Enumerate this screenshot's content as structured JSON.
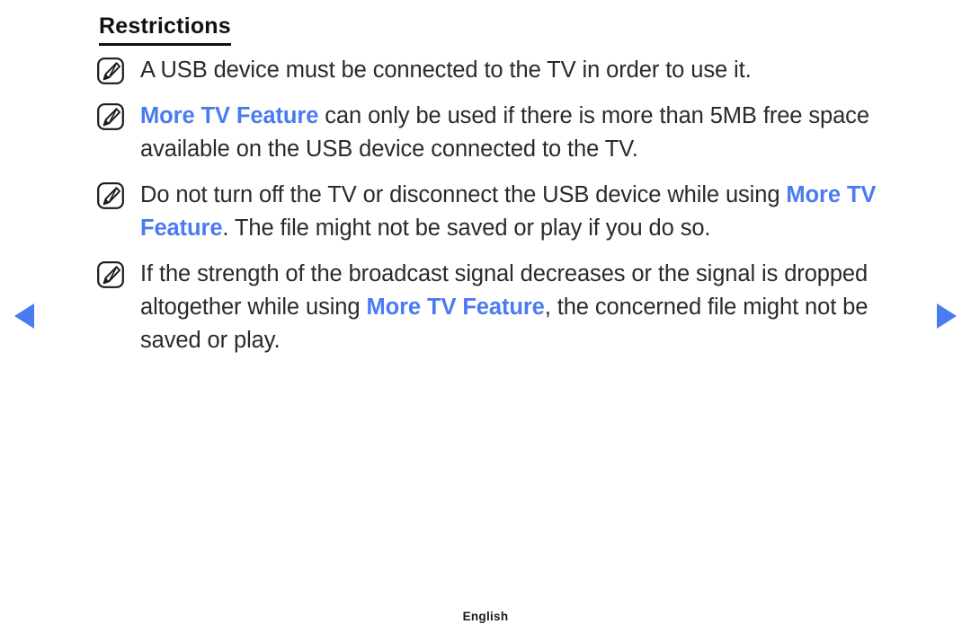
{
  "page": {
    "title": "Restrictions",
    "language_footer": "English",
    "accent_color": "#4a7bf0",
    "text_color": "#2a2a2a",
    "background_color": "#ffffff"
  },
  "navigation": {
    "prev_icon": "triangle-left-icon",
    "next_icon": "triangle-right-icon"
  },
  "notes": [
    {
      "icon": "note-pen-icon",
      "segments": [
        {
          "text": "A USB device must be connected to the TV in order to use it.",
          "style": "normal"
        }
      ]
    },
    {
      "icon": "note-pen-icon",
      "segments": [
        {
          "text": "More TV Feature",
          "style": "highlight"
        },
        {
          "text": " can only be used if there is more than 5MB free space available on the USB device connected to the TV.",
          "style": "normal"
        }
      ]
    },
    {
      "icon": "note-pen-icon",
      "segments": [
        {
          "text": "Do not turn off the TV or disconnect the USB device while using ",
          "style": "normal"
        },
        {
          "text": "More TV Feature",
          "style": "highlight"
        },
        {
          "text": ". The file might not be saved or play if you do so.",
          "style": "normal"
        }
      ]
    },
    {
      "icon": "note-pen-icon",
      "segments": [
        {
          "text": "If the strength of the broadcast signal decreases or the signal is dropped altogether while using ",
          "style": "normal"
        },
        {
          "text": "More TV Feature",
          "style": "highlight"
        },
        {
          "text": ", the concerned file might not be saved or play.",
          "style": "normal"
        }
      ]
    }
  ]
}
